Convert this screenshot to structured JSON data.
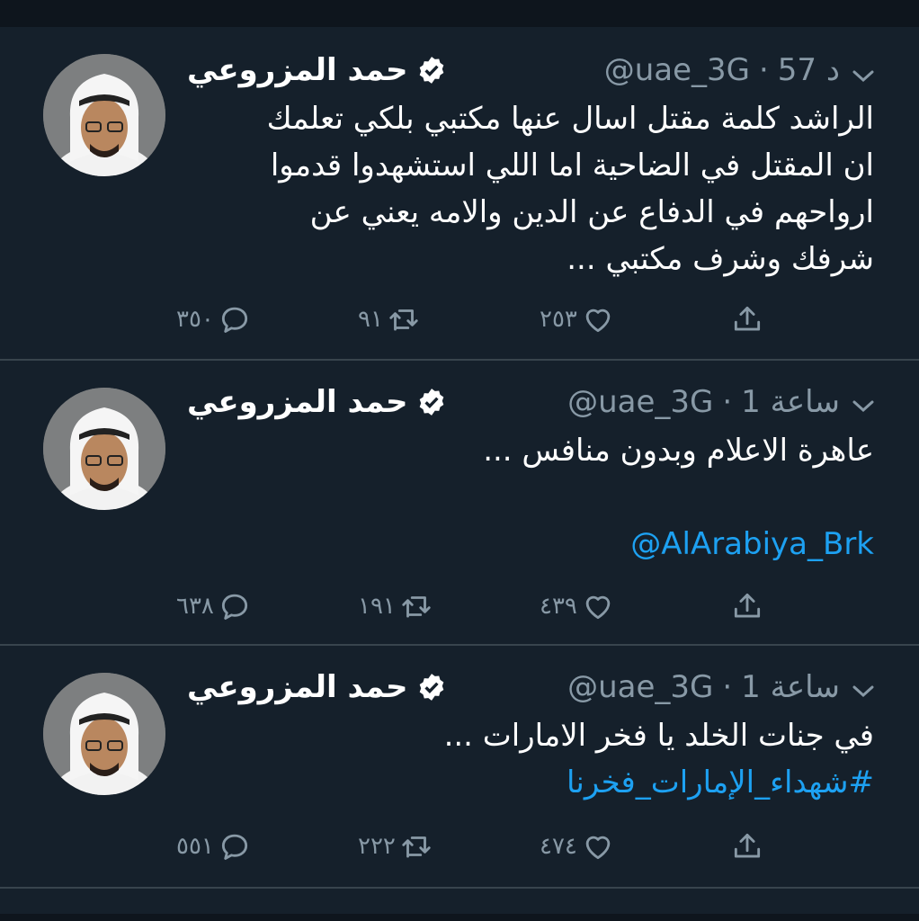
{
  "tweets": [
    {
      "name": "حمد المزروعي",
      "handle": "@uae_3G",
      "time": "57 د",
      "body_lines": [
        "الراشد كلمة مقتل اسال عنها مكتبي بلكي تعلمك",
        "ان المقتل في الضاحية اما اللي استشهدوا قدموا",
        "ارواحهم في الدفاع عن الدين والامه يعني عن",
        "شرفك وشرف مكتبي ..."
      ],
      "link": "",
      "reply_count": "٣٥٠",
      "retweet_count": "٩١",
      "like_count": "٢٥٣"
    },
    {
      "name": "حمد المزروعي",
      "handle": "@uae_3G",
      "time": "1 ساعة",
      "body_lines": [
        "عاهرة الاعلام وبدون منافس ..."
      ],
      "link": "@AlArabiya_Brk",
      "reply_count": "٦٣٨",
      "retweet_count": "١٩١",
      "like_count": "٤٣٩"
    },
    {
      "name": "حمد المزروعي",
      "handle": "@uae_3G",
      "time": "1 ساعة",
      "body_lines": [
        "في جنات الخلد يا فخر الامارات ..."
      ],
      "link": "#شهداء_الإمارات_فخرنا",
      "reply_count": "٥٥١",
      "retweet_count": "٢٢٢",
      "like_count": "٤٧٤"
    }
  ],
  "colors": {
    "background": "#15202b",
    "text": "#ffffff",
    "secondary": "#8899a6",
    "link": "#1da1f2",
    "divider": "#38444d"
  }
}
